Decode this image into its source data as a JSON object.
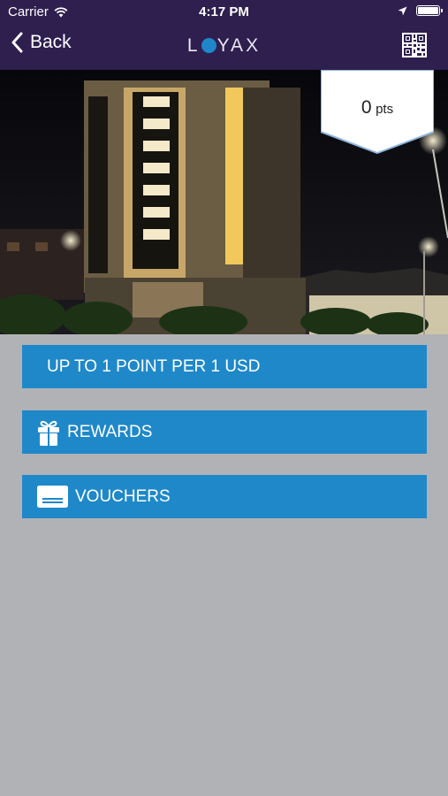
{
  "status_bar": {
    "carrier": "Carrier",
    "time": "4:17 PM",
    "battery_level": 1.0
  },
  "nav": {
    "back_label": "Back",
    "logo_text_before": "L",
    "logo_text_after": "YAX",
    "qr_icon": "qr-code-icon"
  },
  "hero": {
    "points_value": "0",
    "points_unit": "pts"
  },
  "actions": {
    "earn_rate": "UP TO 1 POINT PER 1 USD",
    "rewards_label": "REWARDS",
    "rewards_icon": "gift-icon",
    "vouchers_label": "VOUCHERS",
    "vouchers_icon": "voucher-icon"
  },
  "colors": {
    "header": "#2e1f4f",
    "accent": "#1f88c9",
    "background": "#b1b2b6"
  }
}
